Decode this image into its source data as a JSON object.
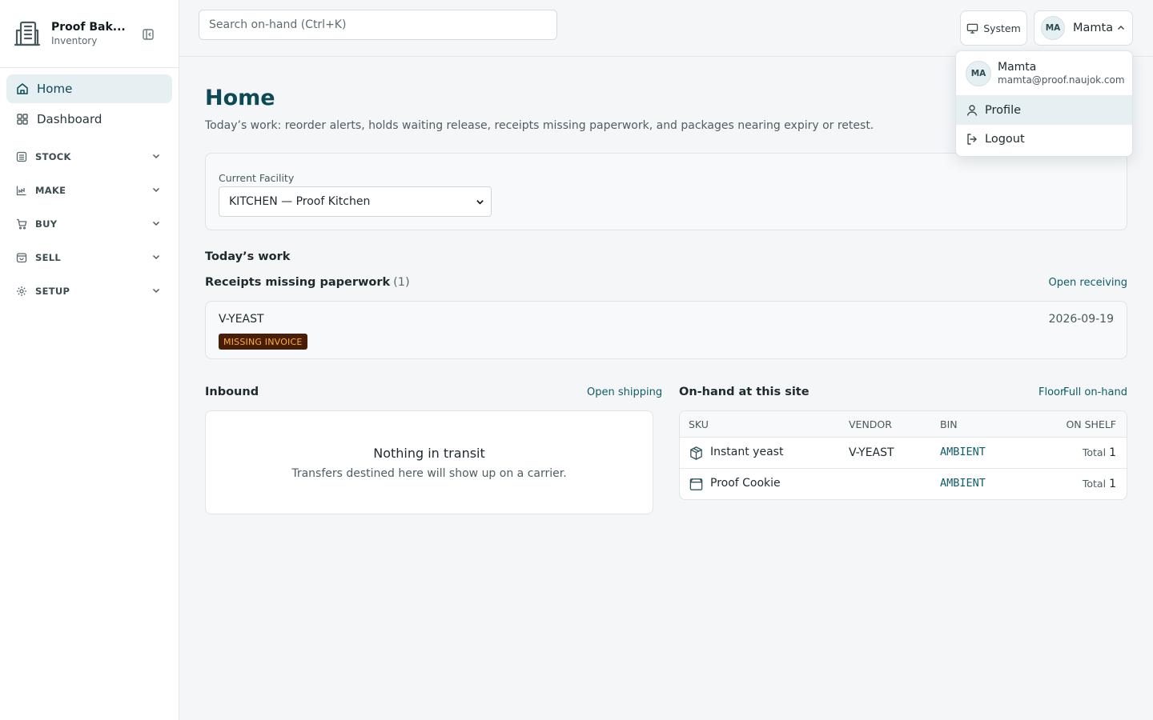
{
  "brand": {
    "name": "Proof Bak...",
    "subtitle": "Inventory"
  },
  "nav": {
    "items": [
      {
        "label": "Home",
        "icon": "home-icon",
        "active": true
      },
      {
        "label": "Dashboard",
        "icon": "grid-icon",
        "active": false
      }
    ],
    "groups": [
      {
        "label": "STOCK",
        "icon": "warehouse-icon"
      },
      {
        "label": "MAKE",
        "icon": "chart-icon"
      },
      {
        "label": "BUY",
        "icon": "cart-icon"
      },
      {
        "label": "SELL",
        "icon": "bag-icon"
      },
      {
        "label": "SETUP",
        "icon": "gear-icon"
      }
    ]
  },
  "topbar": {
    "search_placeholder": "Search on-hand (Ctrl+K)",
    "system_label": "System",
    "user": {
      "initials": "MA",
      "name": "Mamta"
    }
  },
  "user_menu": {
    "initials": "MA",
    "name": "Mamta",
    "email": "mamta@proof.naujok.com",
    "items": [
      {
        "label": "Profile",
        "icon": "user-icon"
      },
      {
        "label": "Logout",
        "icon": "logout-icon"
      }
    ]
  },
  "page": {
    "title": "Home",
    "description": "Today’s work: reorder alerts, holds waiting release, receipts missing paperwork, and packages nearing expiry or retest."
  },
  "facility": {
    "label": "Current Facility",
    "selected": "KITCHEN — Proof Kitchen"
  },
  "todays_work": {
    "title": "Today’s work"
  },
  "receipts": {
    "title": "Receipts missing paperwork",
    "count": "(1)",
    "link": "Open receiving",
    "items": [
      {
        "vendor": "V-YEAST",
        "date": "2026-09-19",
        "badge": "MISSING INVOICE"
      }
    ]
  },
  "inbound": {
    "title": "Inbound",
    "link": "Open shipping",
    "empty_title": "Nothing in transit",
    "empty_subtitle": "Transfers destined here will show up on a carrier."
  },
  "onhand": {
    "title": "On-hand at this site",
    "links": [
      "Floor",
      "Full on-hand"
    ],
    "columns": [
      "SKU",
      "VENDOR",
      "BIN",
      "ON SHELF"
    ],
    "rows": [
      {
        "sku": "Instant yeast",
        "icon": "package-icon",
        "vendor": "V-YEAST",
        "bin": "AMBIENT",
        "total_label": "Total",
        "total": "1"
      },
      {
        "sku": "Proof Cookie",
        "icon": "box-icon",
        "vendor": "",
        "bin": "AMBIENT",
        "total_label": "Total",
        "total": "1"
      }
    ]
  },
  "colors": {
    "accent": "#0d4a56",
    "link": "#0f5c69",
    "badge_bg": "#4a1d08",
    "badge_text": "#f8b13c",
    "active_bg": "#e6eff1"
  }
}
